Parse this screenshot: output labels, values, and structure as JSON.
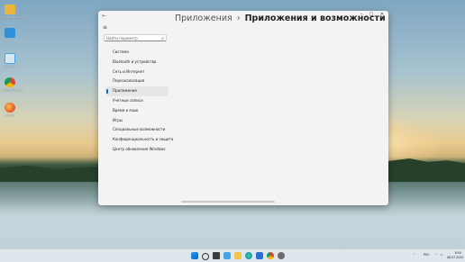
{
  "desktop": {
    "icons": [
      {
        "label": "Этот компьютер",
        "color": "#e8b73a"
      },
      {
        "label": "",
        "color": "#2f8fd8"
      },
      {
        "label": "Корзина",
        "color": "#4aa3e6"
      },
      {
        "label": "Google Chrome",
        "color": "#db4437"
      },
      {
        "label": "Firefox",
        "color": "#e8622c"
      }
    ]
  },
  "window": {
    "breadcrumb_parent": "Приложения",
    "breadcrumb_separator": "›",
    "breadcrumb_current": "Приложения и возможности",
    "back_icon": "←",
    "controls": {
      "minimize": "–",
      "maximize": "□",
      "close": "✕"
    },
    "search_placeholder": "Найти параметр",
    "nav_items": [
      {
        "label": "Система"
      },
      {
        "label": "Bluetooth и устройства"
      },
      {
        "label": "Сеть и Интернет"
      },
      {
        "label": "Персонализация"
      },
      {
        "label": "Приложения",
        "active": true
      },
      {
        "label": "Учетные записи"
      },
      {
        "label": "Время и язык"
      },
      {
        "label": "Игры"
      },
      {
        "label": "Специальные возможности"
      },
      {
        "label": "Конфиденциальность и защита"
      },
      {
        "label": "Центр обновления Windows"
      }
    ]
  },
  "taskbar": {
    "apps": [
      "start-icon",
      "search-icon",
      "task-view-icon",
      "widgets-icon",
      "file-explorer-icon",
      "edge-icon",
      "store-icon",
      "chrome-icon",
      "settings-icon"
    ],
    "tray_lang": "РУС",
    "time": "8:50",
    "date": "08.07.2022",
    "accent": "#0067c0"
  }
}
